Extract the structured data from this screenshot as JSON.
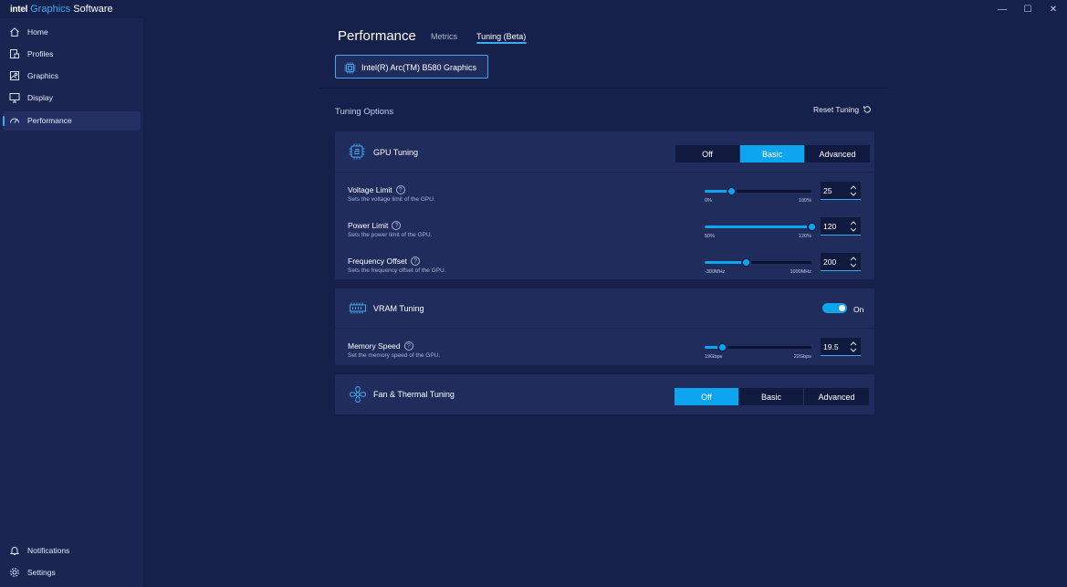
{
  "app": {
    "brand_intel": "intel",
    "brand_name_colored": "Graphics",
    "brand_name_rest": " Software"
  },
  "window_controls": {
    "minimize": "—",
    "maximize": "☐",
    "close": "✕"
  },
  "sidebar": {
    "items": [
      {
        "label": "Home",
        "icon": "home-icon",
        "active": false
      },
      {
        "label": "Profiles",
        "icon": "profiles-icon",
        "active": false
      },
      {
        "label": "Graphics",
        "icon": "graphics-icon",
        "active": false
      },
      {
        "label": "Display",
        "icon": "display-icon",
        "active": false
      },
      {
        "label": "Performance",
        "icon": "performance-icon",
        "active": true
      }
    ],
    "bottom_items": [
      {
        "label": "Notifications",
        "icon": "bell-icon"
      },
      {
        "label": "Settings",
        "icon": "gear-icon"
      }
    ]
  },
  "header": {
    "title": "Performance",
    "tabs": [
      {
        "label": "Metrics",
        "active": false
      },
      {
        "label": "Tuning (Beta)",
        "active": true
      }
    ],
    "gpu_selector": "Intel(R) Arc(TM) B580 Graphics"
  },
  "tuning": {
    "section_title": "Tuning Options",
    "reset_label": "Reset Tuning",
    "gpu_tuning": {
      "title": "GPU Tuning",
      "modes": [
        "Off",
        "Basic",
        "Advanced"
      ],
      "selected_mode": "Basic",
      "controls": [
        {
          "name": "Voltage Limit",
          "help": "?",
          "description": "Sets the voltage limit of the GPU.",
          "min_label": "0%",
          "max_label": "100%",
          "value": "25",
          "fraction": 0.25
        },
        {
          "name": "Power Limit",
          "help": "?",
          "description": "Sets the power limit of the GPU.",
          "min_label": "50%",
          "max_label": "120%",
          "value": "120",
          "fraction": 1.0
        },
        {
          "name": "Frequency Offset",
          "help": "?",
          "description": "Sets the frequency offset of the GPU.",
          "min_label": "-300MHz",
          "max_label": "1000MHz",
          "value": "200",
          "fraction": 0.385
        }
      ]
    },
    "vram_tuning": {
      "title": "VRAM Tuning",
      "toggle_label": "On",
      "toggle_on": true,
      "controls": [
        {
          "name": "Memory Speed",
          "help": "?",
          "description": "Set the memory speed of the GPU.",
          "min_label": "19Gbps",
          "max_label": "22Gbps",
          "value": "19.5",
          "fraction": 0.167
        }
      ]
    },
    "fan_tuning": {
      "title": "Fan & Thermal Tuning",
      "modes": [
        "Off",
        "Basic",
        "Advanced"
      ],
      "selected_mode": "Off"
    }
  },
  "colors": {
    "accent": "#0ea5f0",
    "background": "#16214b",
    "sidebar": "#1a2552",
    "card": "#1f2c5c"
  }
}
